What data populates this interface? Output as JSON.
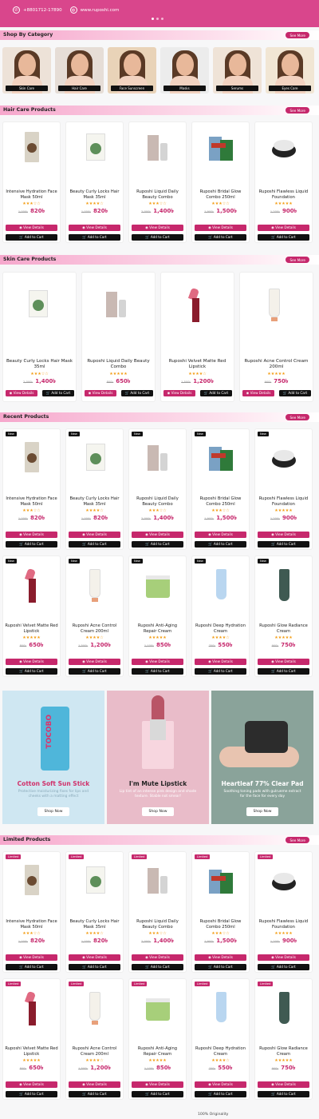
{
  "topbar": {
    "phone": "+8801712-17890",
    "website": "www.ruposhi.com"
  },
  "sections": {
    "category": {
      "title": "Shop By Category",
      "more": "See More"
    },
    "hair": {
      "title": "Hair Care Products",
      "more": "See More"
    },
    "skin": {
      "title": "Skin Care Products",
      "more": "See More"
    },
    "recent": {
      "title": "Recent Products",
      "more": "See More"
    },
    "limited": {
      "title": "Limited Products",
      "more": "See More"
    }
  },
  "categories": [
    "Skin Care",
    "Hair Care",
    "Face Sunscreen",
    "Masks",
    "Serums",
    "Eyes Care"
  ],
  "buttons": {
    "view": "View Details",
    "cart": "Add to Cart"
  },
  "badges": {
    "new": "New",
    "limited": "Limited"
  },
  "hair_products": [
    {
      "name": "Intensive Hydration Face Mask 50ml",
      "old": "1,000৳",
      "price": "820৳",
      "stars": "★★★☆☆"
    },
    {
      "name": "Beauty Curly Locks Hair Mask 35ml",
      "old": "1,000৳",
      "price": "820৳",
      "stars": "★★★★☆"
    },
    {
      "name": "Ruposhi Liquid Daily Beauty Combo",
      "old": "2,000৳",
      "price": "1,400৳",
      "stars": "★★★☆☆"
    },
    {
      "name": "Ruposhi Bridal Glow Combo 250ml",
      "old": "1,900৳",
      "price": "1,500৳",
      "stars": "★★★☆☆"
    },
    {
      "name": "Ruposhi Flawless Liquid Foundation",
      "old": "1,200৳",
      "price": "900৳",
      "stars": "★★★★★"
    }
  ],
  "skin_products": [
    {
      "name": "Beauty Curly Locks Hair Mask 35ml",
      "old": "2,000৳",
      "price": "1,400৳",
      "stars": "★★★☆☆"
    },
    {
      "name": "Ruposhi Liquid Daily Beauty Combo",
      "old": "800৳",
      "price": "650৳",
      "stars": "★★★★★"
    },
    {
      "name": "Ruposhi Velvet Matte Red Lipstick",
      "old": "1,500৳",
      "price": "1,200৳",
      "stars": "★★★★☆"
    },
    {
      "name": "Ruposhi Acne Control Cream 200ml",
      "old": "900৳",
      "price": "750৳",
      "stars": "★★★★★"
    }
  ],
  "recent_row1": [
    {
      "name": "Intensive Hydration Face Mask 50ml",
      "old": "1,000৳",
      "price": "820৳",
      "stars": "★★★☆☆"
    },
    {
      "name": "Beauty Curly Locks Hair Mask 35ml",
      "old": "1,000৳",
      "price": "820৳",
      "stars": "★★★★☆"
    },
    {
      "name": "Ruposhi Liquid Daily Beauty Combo",
      "old": "2,000৳",
      "price": "1,400৳",
      "stars": "★★★☆☆"
    },
    {
      "name": "Ruposhi Bridal Glow Combo 250ml",
      "old": "1,900৳",
      "price": "1,500৳",
      "stars": "★★★☆☆"
    },
    {
      "name": "Ruposhi Flawless Liquid Foundation",
      "old": "1,200৳",
      "price": "900৳",
      "stars": "★★★★★"
    }
  ],
  "recent_row2": [
    {
      "name": "Ruposhi Velvet Matte Red Lipstick",
      "old": "800৳",
      "price": "650৳",
      "stars": "★★★★★"
    },
    {
      "name": "Ruposhi Acne Control Cream 200ml",
      "old": "1,500৳",
      "price": "1,200৳",
      "stars": "★★★★☆"
    },
    {
      "name": "Ruposhi Anti-Aging Repair Cream",
      "old": "1,100৳",
      "price": "850৳",
      "stars": "★★★★★"
    },
    {
      "name": "Ruposhi Deep Hydration Cream",
      "old": "700৳",
      "price": "550৳",
      "stars": "★★★★☆"
    },
    {
      "name": "Ruposhi Glow Radiance Cream",
      "old": "900৳",
      "price": "750৳",
      "stars": "★★★★★"
    }
  ],
  "banners": [
    {
      "title": "Cotton Soft Sun Stick",
      "text": "Protective moisturizing fixes for lips and cheeks with a matting effect",
      "btn": "Shop Now",
      "brand": "TOCOBO"
    },
    {
      "title": "I'm Mute Lipstick",
      "text": "Lip tint of an intense pink design and shade texture. Stable not smear!",
      "btn": "Shop Now"
    },
    {
      "title": "Heartleaf 77% Clear Pad",
      "text": "Soothing toning pads with gulrueme extract for the face for every day",
      "btn": "Shop Now"
    }
  ],
  "limited_row1": [
    {
      "name": "Intensive Hydration Face Mask 50ml",
      "old": "1,000৳",
      "price": "820৳",
      "stars": "★★★☆☆"
    },
    {
      "name": "Beauty Curly Locks Hair Mask 35ml",
      "old": "1,000৳",
      "price": "820৳",
      "stars": "★★★★☆"
    },
    {
      "name": "Ruposhi Liquid Daily Beauty Combo",
      "old": "2,000৳",
      "price": "1,400৳",
      "stars": "★★★☆☆"
    },
    {
      "name": "Ruposhi Bridal Glow Combo 250ml",
      "old": "1,900৳",
      "price": "1,500৳",
      "stars": "★★★☆☆"
    },
    {
      "name": "Ruposhi Flawless Liquid Foundation",
      "old": "1,200৳",
      "price": "900৳",
      "stars": "★★★★★"
    }
  ],
  "limited_row2": [
    {
      "name": "Ruposhi Velvet Matte Red Lipstick",
      "old": "800৳",
      "price": "650৳",
      "stars": "★★★★★"
    },
    {
      "name": "Ruposhi Acne Control Cream 200ml",
      "old": "1,500৳",
      "price": "1,200৳",
      "stars": "★★★★☆"
    },
    {
      "name": "Ruposhi Anti-Aging Repair Cream",
      "old": "1,100৳",
      "price": "850৳",
      "stars": "★★★★★"
    },
    {
      "name": "Ruposhi Deep Hydration Cream",
      "old": "700৳",
      "price": "550৳",
      "stars": "★★★★☆"
    },
    {
      "name": "Ruposhi Glow Radiance Cream",
      "old": "900৳",
      "price": "750৳",
      "stars": "★★★★★"
    }
  ],
  "footer": {
    "feature": "100% Originality"
  },
  "colors": {
    "accent": "#c6286c",
    "topbar": "#d9468c",
    "dark": "#111111"
  }
}
